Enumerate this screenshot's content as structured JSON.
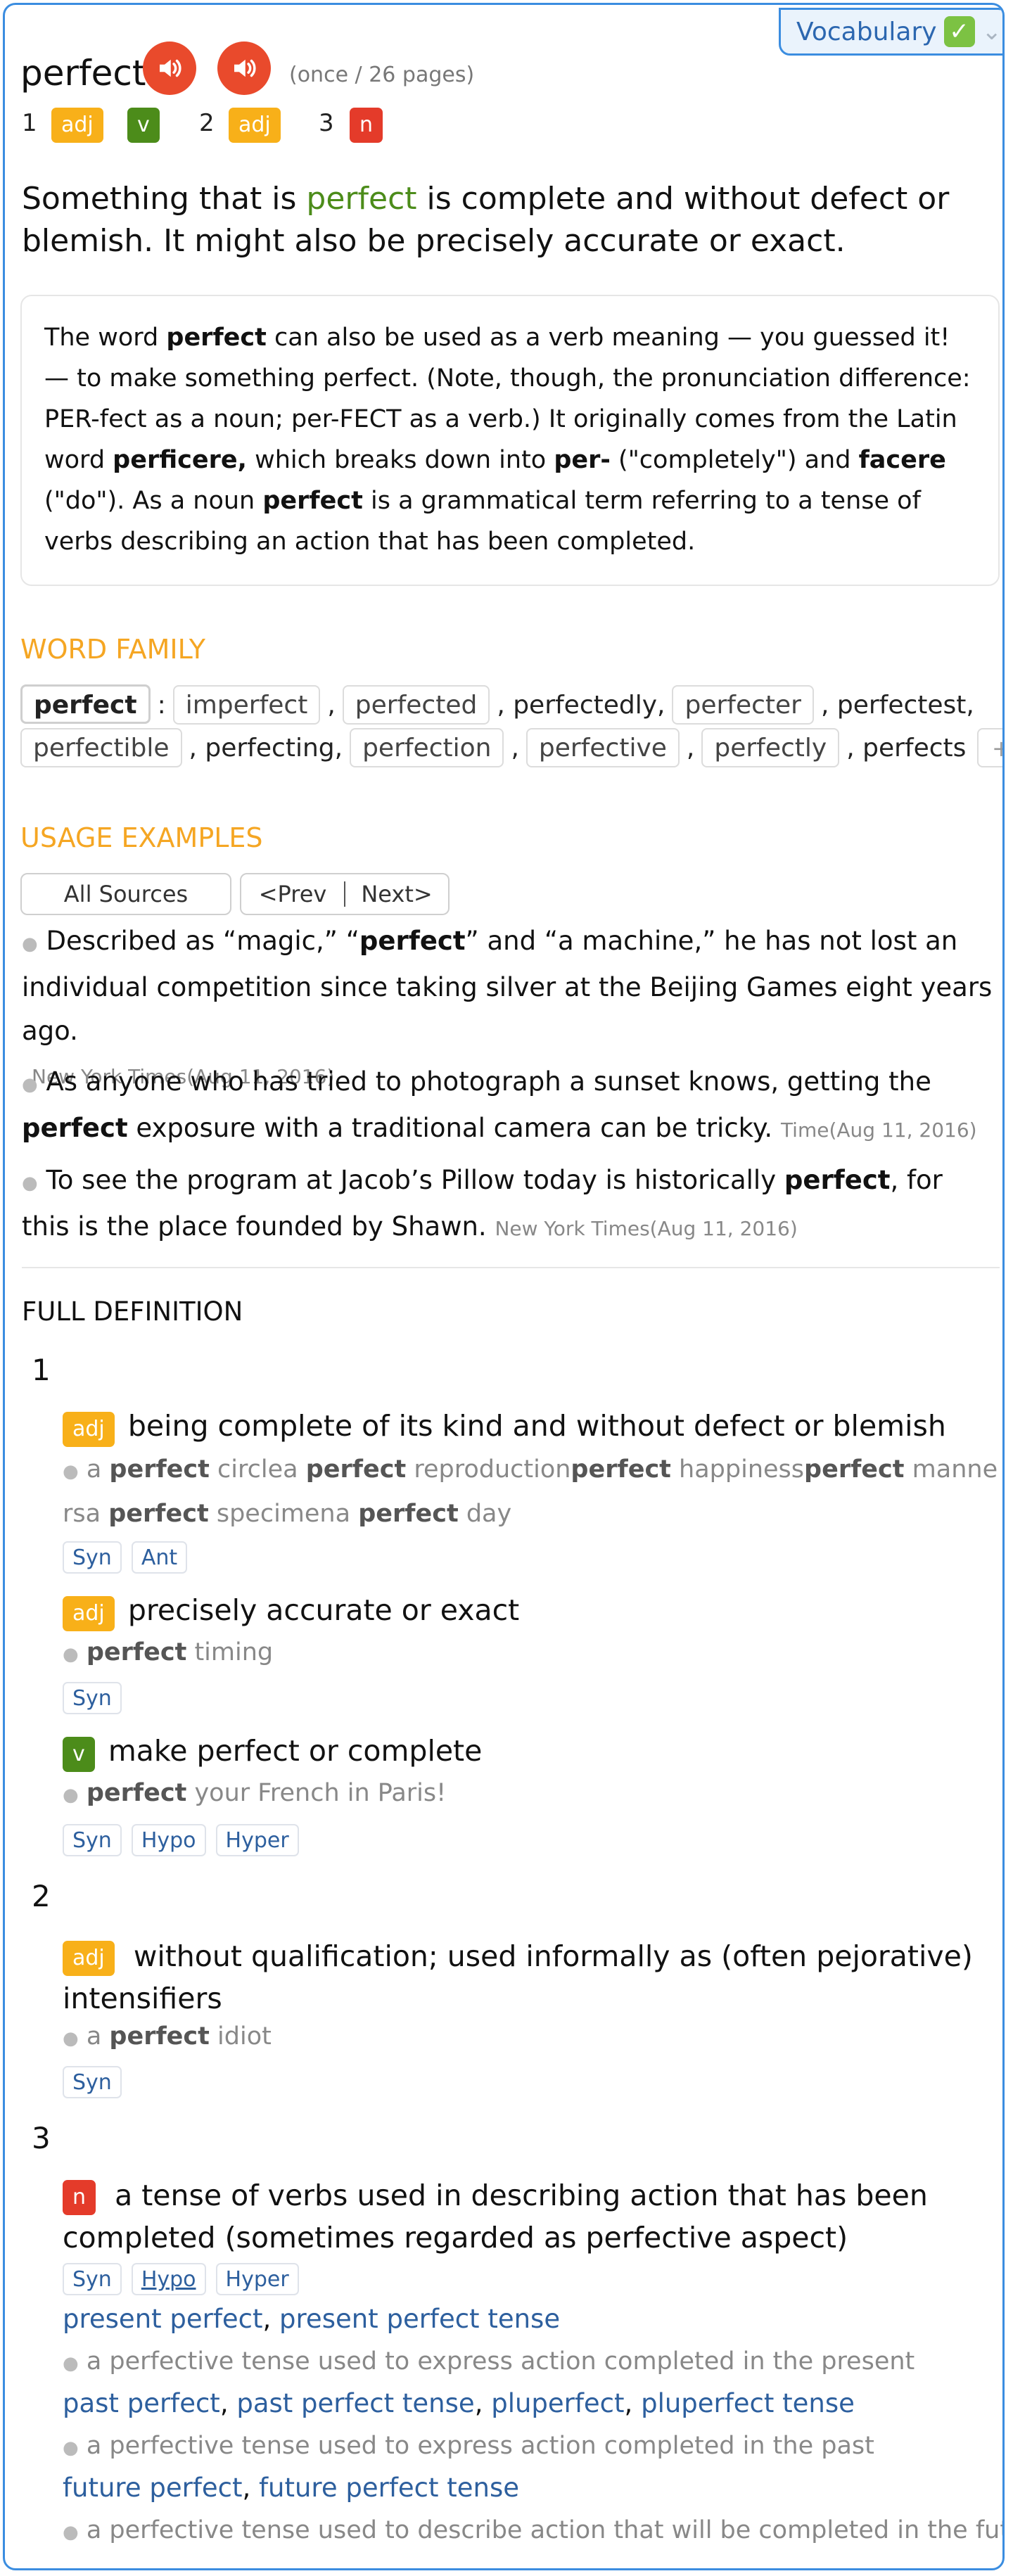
{
  "vocab_tab": {
    "label": "Vocabulary"
  },
  "header": {
    "word": "perfect",
    "frequency": "(once / 26 pages)"
  },
  "sense_nav": [
    {
      "num": "1",
      "badges": [
        "adj",
        "v"
      ]
    },
    {
      "num": "2",
      "badges": [
        "adj"
      ]
    },
    {
      "num": "3",
      "badges": [
        "n"
      ]
    }
  ],
  "short_def": {
    "pre": "Something that is ",
    "word": "perfect",
    "post": " is complete and without defect or blemish. It might also be precisely accurate or exact."
  },
  "long_def": {
    "p1": "The word ",
    "b1": "perfect",
    "p2": " can also be used as a verb meaning — you guessed it! — to make something perfect. (Note, though, the pronunciation difference: PER-fect as a noun; per-FECT as a verb.) It originally comes from the Latin word ",
    "b2": "perficere,",
    "p3": " which breaks down into ",
    "b3": "per-",
    "p4": " (\"completely\") and ",
    "b4": "facere",
    "p5": " (\"do\"). As a noun ",
    "b5": "perfect",
    "p6": " is a grammatical term referring to a tense of verbs describing an action that has been completed."
  },
  "word_family": {
    "heading": "WORD FAMILY",
    "root": "perfect",
    "colon": ":",
    "row1": [
      "imperfect",
      ",",
      "perfected",
      ", perfectedly,",
      "perfecter",
      ", perfectest,"
    ],
    "row2": [
      "perfectible",
      ", perfecting,",
      "perfection",
      ",",
      "perfective",
      ",",
      "perfectly",
      ", perfects"
    ],
    "more": "+"
  },
  "usage": {
    "heading": "USAGE EXAMPLES",
    "sources_button": "All Sources",
    "prev_button": "<Prev",
    "next_button": "Next>",
    "examples": [
      {
        "pre": "Described as “magic,” “",
        "bold": "perfect",
        "post": "” and “a machine,” he has not lost an individual competition since taking silver at the Beijing Games eight years ago.",
        "source": "New York Times(Aug 11, 2016)"
      },
      {
        "pre": "As anyone who has tried to photograph a sunset knows, getting the ",
        "bold": "perfect",
        "post": " exposure with a traditional camera can be tricky.",
        "source": "Time(Aug 11, 2016)"
      },
      {
        "pre": "To see the program at Jacob’s Pillow today is historically ",
        "bold": "perfect",
        "post": ", for this is the place founded by Shawn.",
        "source": "New York Times(Aug 11, 2016)"
      }
    ]
  },
  "full_definition": {
    "heading": "FULL DEFINITION",
    "groups": [
      {
        "num": "1",
        "senses": [
          {
            "pos": "adj",
            "definition": "being complete of its kind and without defect or blemish",
            "example_parts": [
              "a ",
              "perfect",
              " circle",
              "a ",
              "perfect",
              " reproduction",
              "perfect",
              " happiness",
              "perfect",
              " manners",
              "a ",
              "per",
              "fect",
              " specimen",
              "a ",
              "perfect",
              " day"
            ],
            "tags": [
              "Syn",
              "Ant"
            ]
          },
          {
            "pos": "adj",
            "definition": "precisely accurate or exact",
            "example_parts": [
              "perfect",
              " timing"
            ],
            "tags": [
              "Syn"
            ]
          },
          {
            "pos": "v",
            "definition": "make perfect or complete",
            "example_parts": [
              "perfect",
              " your French in Paris!"
            ],
            "tags": [
              "Syn",
              "Hypo",
              "Hyper"
            ]
          }
        ]
      },
      {
        "num": "2",
        "senses": [
          {
            "pos": "adj",
            "definition": "without qualification; used informally as (often pejorative) intensifiers",
            "example_parts": [
              "a ",
              "perfect",
              " idiot"
            ],
            "tags": [
              "Syn"
            ]
          }
        ]
      },
      {
        "num": "3",
        "senses": [
          {
            "pos": "n",
            "definition": "a tense of verbs used in describing action that has been completed (sometimes regarded as perfective aspect)",
            "tags": [
              "Syn",
              "Hypo",
              "Hyper"
            ],
            "hyponyms": [
              {
                "terms": [
                  "present perfect",
                  "present perfect tense"
                ],
                "gloss": "a perfective tense used to express action completed in the present"
              },
              {
                "terms": [
                  "past perfect",
                  "past perfect tense",
                  "pluperfect",
                  "pluperfect tense"
                ],
                "gloss": "a perfective tense used to express action completed in the past"
              },
              {
                "terms": [
                  "future perfect",
                  "future perfect tense"
                ],
                "gloss": "a perfective tense used to describe action that will be completed in the future"
              }
            ]
          }
        ]
      }
    ]
  },
  "colors": {
    "accent_blue": "#3b8de0",
    "adj": "#f8b019",
    "verb": "#4c8c1a",
    "noun": "#e43b2a",
    "section_heading": "#f5a623",
    "speaker": "#e94a2c"
  }
}
